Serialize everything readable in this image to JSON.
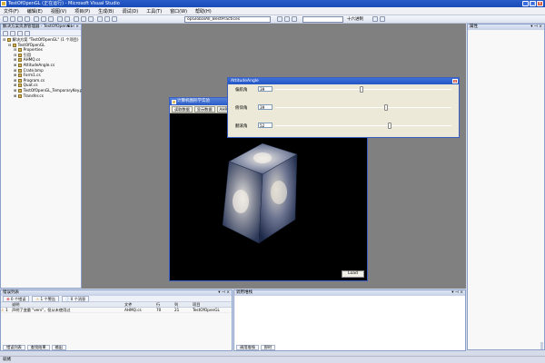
{
  "window": {
    "title": "TestOfOpenGL (正在运行) - Microsoft Visual Studio"
  },
  "menu": [
    "文件(F)",
    "编辑(E)",
    "视图(V)",
    "项目(P)",
    "生成(B)",
    "调试(D)",
    "工具(T)",
    "窗口(W)",
    "帮助(H)"
  ],
  "toolbar": {
    "config_value": "opGlobalAll_BestPractices",
    "find_label": "十六进制"
  },
  "solution_explorer": {
    "title": "解决方案资源管理器 - TestOfOpenGL",
    "items": [
      {
        "label": "解决方案 \"TestOfOpenGL\" (1 个项目)",
        "indent": 0
      },
      {
        "label": "TestOfOpenGL",
        "indent": 1
      },
      {
        "label": "Properties",
        "indent": 2
      },
      {
        "label": "引用",
        "indent": 2
      },
      {
        "label": "AHMQ.cs",
        "indent": 2
      },
      {
        "label": "AttitudeAngle.cs",
        "indent": 2
      },
      {
        "label": "Crate.bmp",
        "indent": 2
      },
      {
        "label": "Form1.cs",
        "indent": 2
      },
      {
        "label": "Program.cs",
        "indent": 2
      },
      {
        "label": "Quat.cs",
        "indent": 2
      },
      {
        "label": "TestOfOpenGL_TemporaryKey.pfx",
        "indent": 2
      },
      {
        "label": "Transfer.cs",
        "indent": 2
      }
    ]
  },
  "properties": {
    "title": "属性"
  },
  "error_list": {
    "title": "错误列表",
    "tabs": [
      "0 个错误",
      "1 个警告",
      "0 个消息"
    ],
    "columns": [
      "",
      "说明",
      "文件",
      "行",
      "列",
      "项目"
    ],
    "rows": [
      {
        "n": "1",
        "desc": "声明了变量 \"vers\"，但从未使用过",
        "file": "AHMQ.cs",
        "line": "70",
        "col": "21",
        "project": "TestOfOpenGL"
      }
    ],
    "bottom_tabs": [
      "错误列表",
      "查找结果",
      "输出"
    ]
  },
  "output": {
    "title": "调用堆栈",
    "bottom_tabs": [
      "调用堆栈",
      "即时"
    ]
  },
  "status": {
    "text": "就绪"
  },
  "app": {
    "title": "计算机图形学实验",
    "tools": [
      "读取数据",
      "显示数据",
      "AHRS"
    ],
    "load_button": "Load"
  },
  "rotation_dialog": {
    "title": "AttitudeAngle",
    "rows": [
      {
        "label": "偏航角",
        "value": "39",
        "level": 0.48
      },
      {
        "label": "俯仰角",
        "value": "39",
        "level": 0.62
      },
      {
        "label": "翻滚角",
        "value": "52",
        "level": 0.64
      }
    ]
  }
}
